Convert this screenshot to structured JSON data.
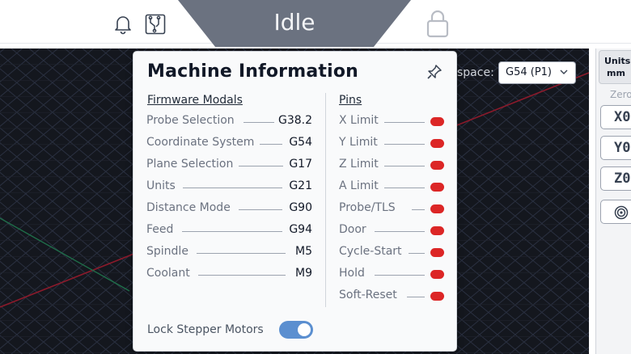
{
  "header": {
    "status": "Idle",
    "icons": [
      "bell-icon",
      "circuit-board-icon",
      "lock-icon"
    ]
  },
  "visualizer": {
    "workspace_label": "space:",
    "workspace_value": "G54 (P1)"
  },
  "side_panel": {
    "units_label": "Units:",
    "units_value": "mm",
    "zero_label": "Zero",
    "axes": [
      "X0",
      "Y0",
      "Z0"
    ]
  },
  "popup": {
    "title": "Machine Information",
    "modals_heading": "Firmware Modals",
    "pins_heading": "Pins",
    "modals": [
      {
        "label": "Probe Selection",
        "value": "G38.2"
      },
      {
        "label": "Coordinate System",
        "value": "G54"
      },
      {
        "label": "Plane Selection",
        "value": "G17"
      },
      {
        "label": "Units",
        "value": "G21"
      },
      {
        "label": "Distance Mode",
        "value": "G90"
      },
      {
        "label": "Feed",
        "value": "G94"
      },
      {
        "label": "Spindle",
        "value": "M5"
      },
      {
        "label": "Coolant",
        "value": "M9"
      }
    ],
    "pins": [
      {
        "label": "X Limit",
        "state": "red"
      },
      {
        "label": "Y Limit",
        "state": "red"
      },
      {
        "label": "Z Limit",
        "state": "red"
      },
      {
        "label": "A Limit",
        "state": "red"
      },
      {
        "label": "Probe/TLS",
        "state": "red"
      },
      {
        "label": "Door",
        "state": "red"
      },
      {
        "label": "Cycle-Start",
        "state": "red"
      },
      {
        "label": "Hold",
        "state": "red"
      },
      {
        "label": "Soft-Reset",
        "state": "red"
      }
    ],
    "lock_label": "Lock Stepper Motors",
    "lock_enabled": true
  },
  "colors": {
    "status_bg": "#6b7280",
    "visualizer_bg": "#14171e",
    "led_red": "#dc2626",
    "toggle_on": "#5b8fd0"
  }
}
